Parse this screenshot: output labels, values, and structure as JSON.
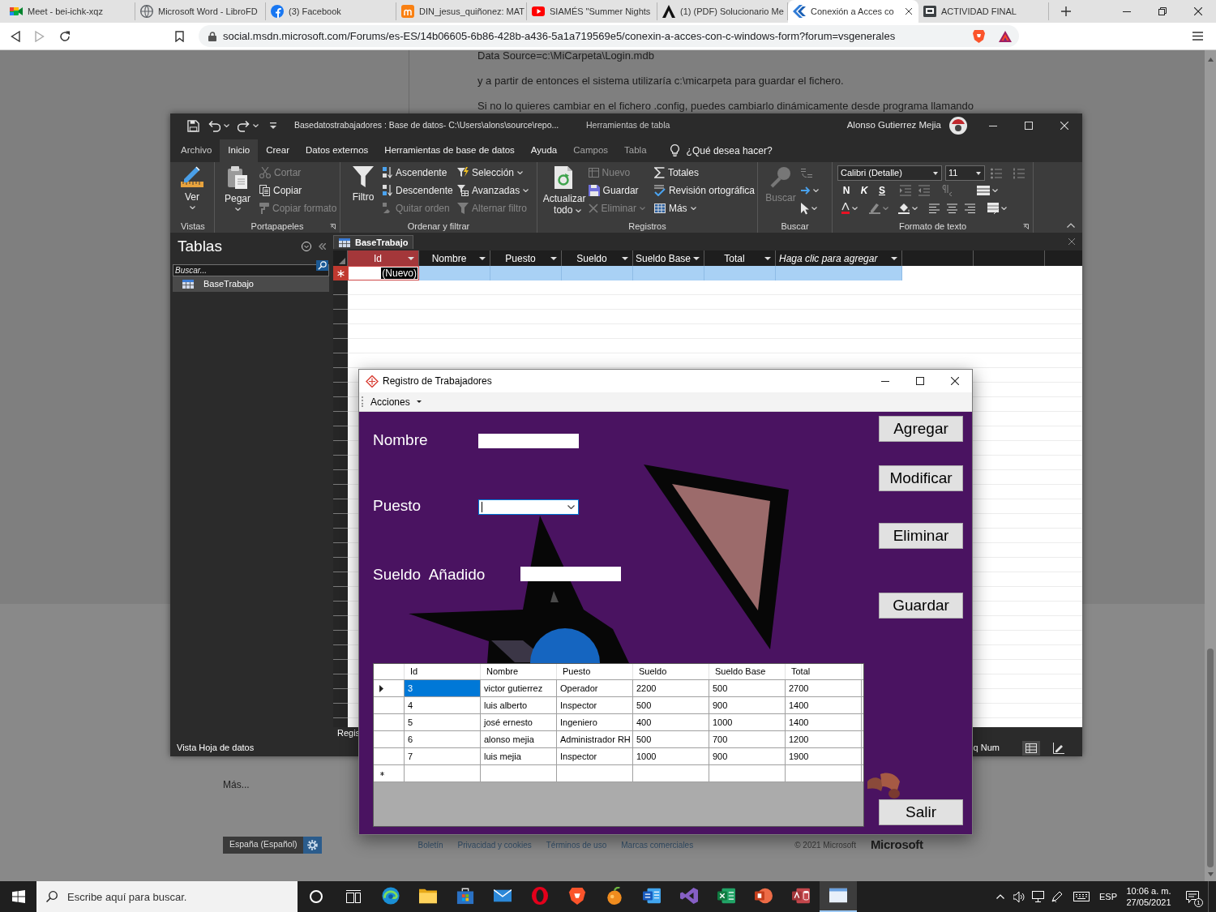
{
  "browser": {
    "tabs": [
      {
        "title": "Meet - bei-ichk-xqz",
        "selected": false
      },
      {
        "title": "Microsoft Word - LibroFD",
        "selected": false
      },
      {
        "title": "(3) Facebook",
        "selected": false
      },
      {
        "title": "DIN_jesus_quiñonez: MAT",
        "selected": false
      },
      {
        "title": "SIAMÉS \"Summer Nights",
        "selected": false
      },
      {
        "title": "(1) (PDF) Solucionario Me",
        "selected": false
      },
      {
        "title": "Conexión a Acces co",
        "selected": true
      },
      {
        "title": "ACTIVIDAD FINAL",
        "selected": false
      }
    ],
    "url": "social.msdn.microsoft.com/Forums/es-ES/14b06605-6b86-428b-a436-5a1a719569e5/conexin-a-acces-con-c-windows-form?forum=vsgenerales"
  },
  "page": {
    "lines": [
      "Data Source=c:\\MiCarpeta\\Login.mdb",
      "y a partir de entonces el sistema utilizaría c:\\micarpeta para guardar el fichero.",
      "Si no lo quieres cambiar en el fichero .config, puedes cambiarlo dinámicamente desde programa llamando"
    ],
    "more": "Más...",
    "locale": "España (Español)",
    "footer_links": [
      "Boletín",
      "Privacidad y cookies",
      "Términos de uso",
      "Marcas comerciales"
    ],
    "copyright": "© 2021 Microsoft",
    "brand": "Microsoft"
  },
  "access": {
    "title": "Basedatostrabajadores : Base de datos- C:\\Users\\alons\\source\\repo...",
    "context": "Herramientas de tabla",
    "user": "Alonso Gutierrez Mejia",
    "tabs": [
      {
        "label": "Archivo",
        "selected": false,
        "kind": "file"
      },
      {
        "label": "Inicio",
        "selected": true,
        "kind": "main"
      },
      {
        "label": "Crear",
        "selected": false,
        "kind": "main"
      },
      {
        "label": "Datos externos",
        "selected": false,
        "kind": "main"
      },
      {
        "label": "Herramientas de base de datos",
        "selected": false,
        "kind": "main"
      },
      {
        "label": "Ayuda",
        "selected": false,
        "kind": "main"
      },
      {
        "label": "Campos",
        "selected": false,
        "kind": "context"
      },
      {
        "label": "Tabla",
        "selected": false,
        "kind": "context"
      }
    ],
    "tell_me": {
      "placeholder": "¿Qué desea hacer?"
    },
    "ribbon": [
      {
        "label": "Vistas",
        "commands": [
          {
            "label": "Ver",
            "disabled": false
          }
        ]
      },
      {
        "label": "Portapapeles",
        "commands": [
          {
            "label": "Pegar",
            "disabled": false
          },
          {
            "label": "Cortar",
            "disabled": true
          },
          {
            "label": "Copiar",
            "disabled": false
          },
          {
            "label": "Copiar formato",
            "disabled": true
          }
        ]
      },
      {
        "label": "Ordenar y filtrar",
        "commands": [
          {
            "label": "Filtro",
            "disabled": false
          },
          {
            "label": "Ascendente",
            "disabled": false
          },
          {
            "label": "Descendente",
            "disabled": false
          },
          {
            "label": "Quitar orden",
            "disabled": true
          },
          {
            "label": "Selección",
            "disabled": false
          },
          {
            "label": "Avanzadas",
            "disabled": false
          },
          {
            "label": "Alternar filtro",
            "disabled": true
          }
        ]
      },
      {
        "label": "Registros",
        "commands": [
          {
            "label": "Actualizar todo",
            "disabled": false
          },
          {
            "label": "Nuevo",
            "disabled": true
          },
          {
            "label": "Guardar",
            "disabled": false
          },
          {
            "label": "Eliminar",
            "disabled": true
          },
          {
            "label": "Totales",
            "disabled": false
          },
          {
            "label": "Revisión ortográfica",
            "disabled": false
          },
          {
            "label": "Más",
            "disabled": false
          }
        ]
      },
      {
        "label": "Buscar",
        "commands": [
          {
            "label": "Buscar",
            "disabled": true
          }
        ]
      },
      {
        "label": "Formato de texto",
        "font": "Calibri (Detalle)",
        "size": "11",
        "styles": [
          "N",
          "K",
          "S"
        ]
      }
    ],
    "nav": {
      "title": "Tablas",
      "placeholder": "Buscar...",
      "items": [
        {
          "label": "BaseTrabajo",
          "selected": true
        }
      ]
    },
    "datasheet": {
      "tab": "BaseTrabajo",
      "columns": [
        {
          "label": "Id",
          "selected": true,
          "kind": "field"
        },
        {
          "label": "Nombre",
          "selected": false,
          "kind": "field"
        },
        {
          "label": "Puesto",
          "selected": false,
          "kind": "field"
        },
        {
          "label": "Sueldo",
          "selected": false,
          "kind": "field"
        },
        {
          "label": "Sueldo Base",
          "selected": false,
          "kind": "field"
        },
        {
          "label": "Total",
          "selected": false,
          "kind": "field"
        },
        {
          "label": "Haga clic para agregar",
          "selected": false,
          "kind": "add"
        }
      ],
      "new_record": "(Nuevo)",
      "record_nav": "Regis"
    },
    "status": {
      "view": "Vista Hoja de datos",
      "indicator": "q Num"
    }
  },
  "dialog": {
    "title": "Registro de Trabajadores",
    "menu": [
      {
        "label": "Acciones"
      }
    ],
    "fields": [
      {
        "label": "Nombre",
        "kind": "text",
        "focused": false
      },
      {
        "label": "Puesto",
        "kind": "combo",
        "focused": true
      },
      {
        "label": "Sueldo  Añadido",
        "kind": "text",
        "focused": false
      }
    ],
    "buttons": [
      "Agregar",
      "Modificar",
      "Eliminar",
      "Guardar",
      "Salir"
    ],
    "grid": {
      "columns": [
        "Id",
        "Nombre",
        "Puesto",
        "Sueldo",
        "Sueldo Base",
        "Total"
      ],
      "rows": [
        {
          "cells": [
            "3",
            "victor gutierrez",
            "Operador",
            "2200",
            "500",
            "2700"
          ],
          "selected": true
        },
        {
          "cells": [
            "4",
            "luis alberto",
            "Inspector",
            "500",
            "900",
            "1400"
          ],
          "selected": false
        },
        {
          "cells": [
            "5",
            "josé ernesto",
            "Ingeniero",
            "400",
            "1000",
            "1400"
          ],
          "selected": false
        },
        {
          "cells": [
            "6",
            "alonso mejia",
            "Administrador RH",
            "500",
            "700",
            "1200"
          ],
          "selected": false
        },
        {
          "cells": [
            "7",
            "luis mejia",
            "Inspector",
            "1000",
            "900",
            "1900"
          ],
          "selected": false
        }
      ],
      "new_row": true
    }
  },
  "taskbar": {
    "search_placeholder": "Escribe aquí para buscar.",
    "apps": [
      {
        "selected": false
      },
      {
        "selected": false
      },
      {
        "selected": false
      },
      {
        "selected": false
      },
      {
        "selected": false
      },
      {
        "selected": false
      },
      {
        "selected": false
      },
      {
        "selected": false
      },
      {
        "selected": false
      },
      {
        "selected": false
      },
      {
        "selected": false
      },
      {
        "selected": false
      },
      {
        "selected": true
      }
    ],
    "language": "ESP",
    "time": "10:06 a. m.",
    "date": "27/05/2021",
    "notifications": "1"
  }
}
